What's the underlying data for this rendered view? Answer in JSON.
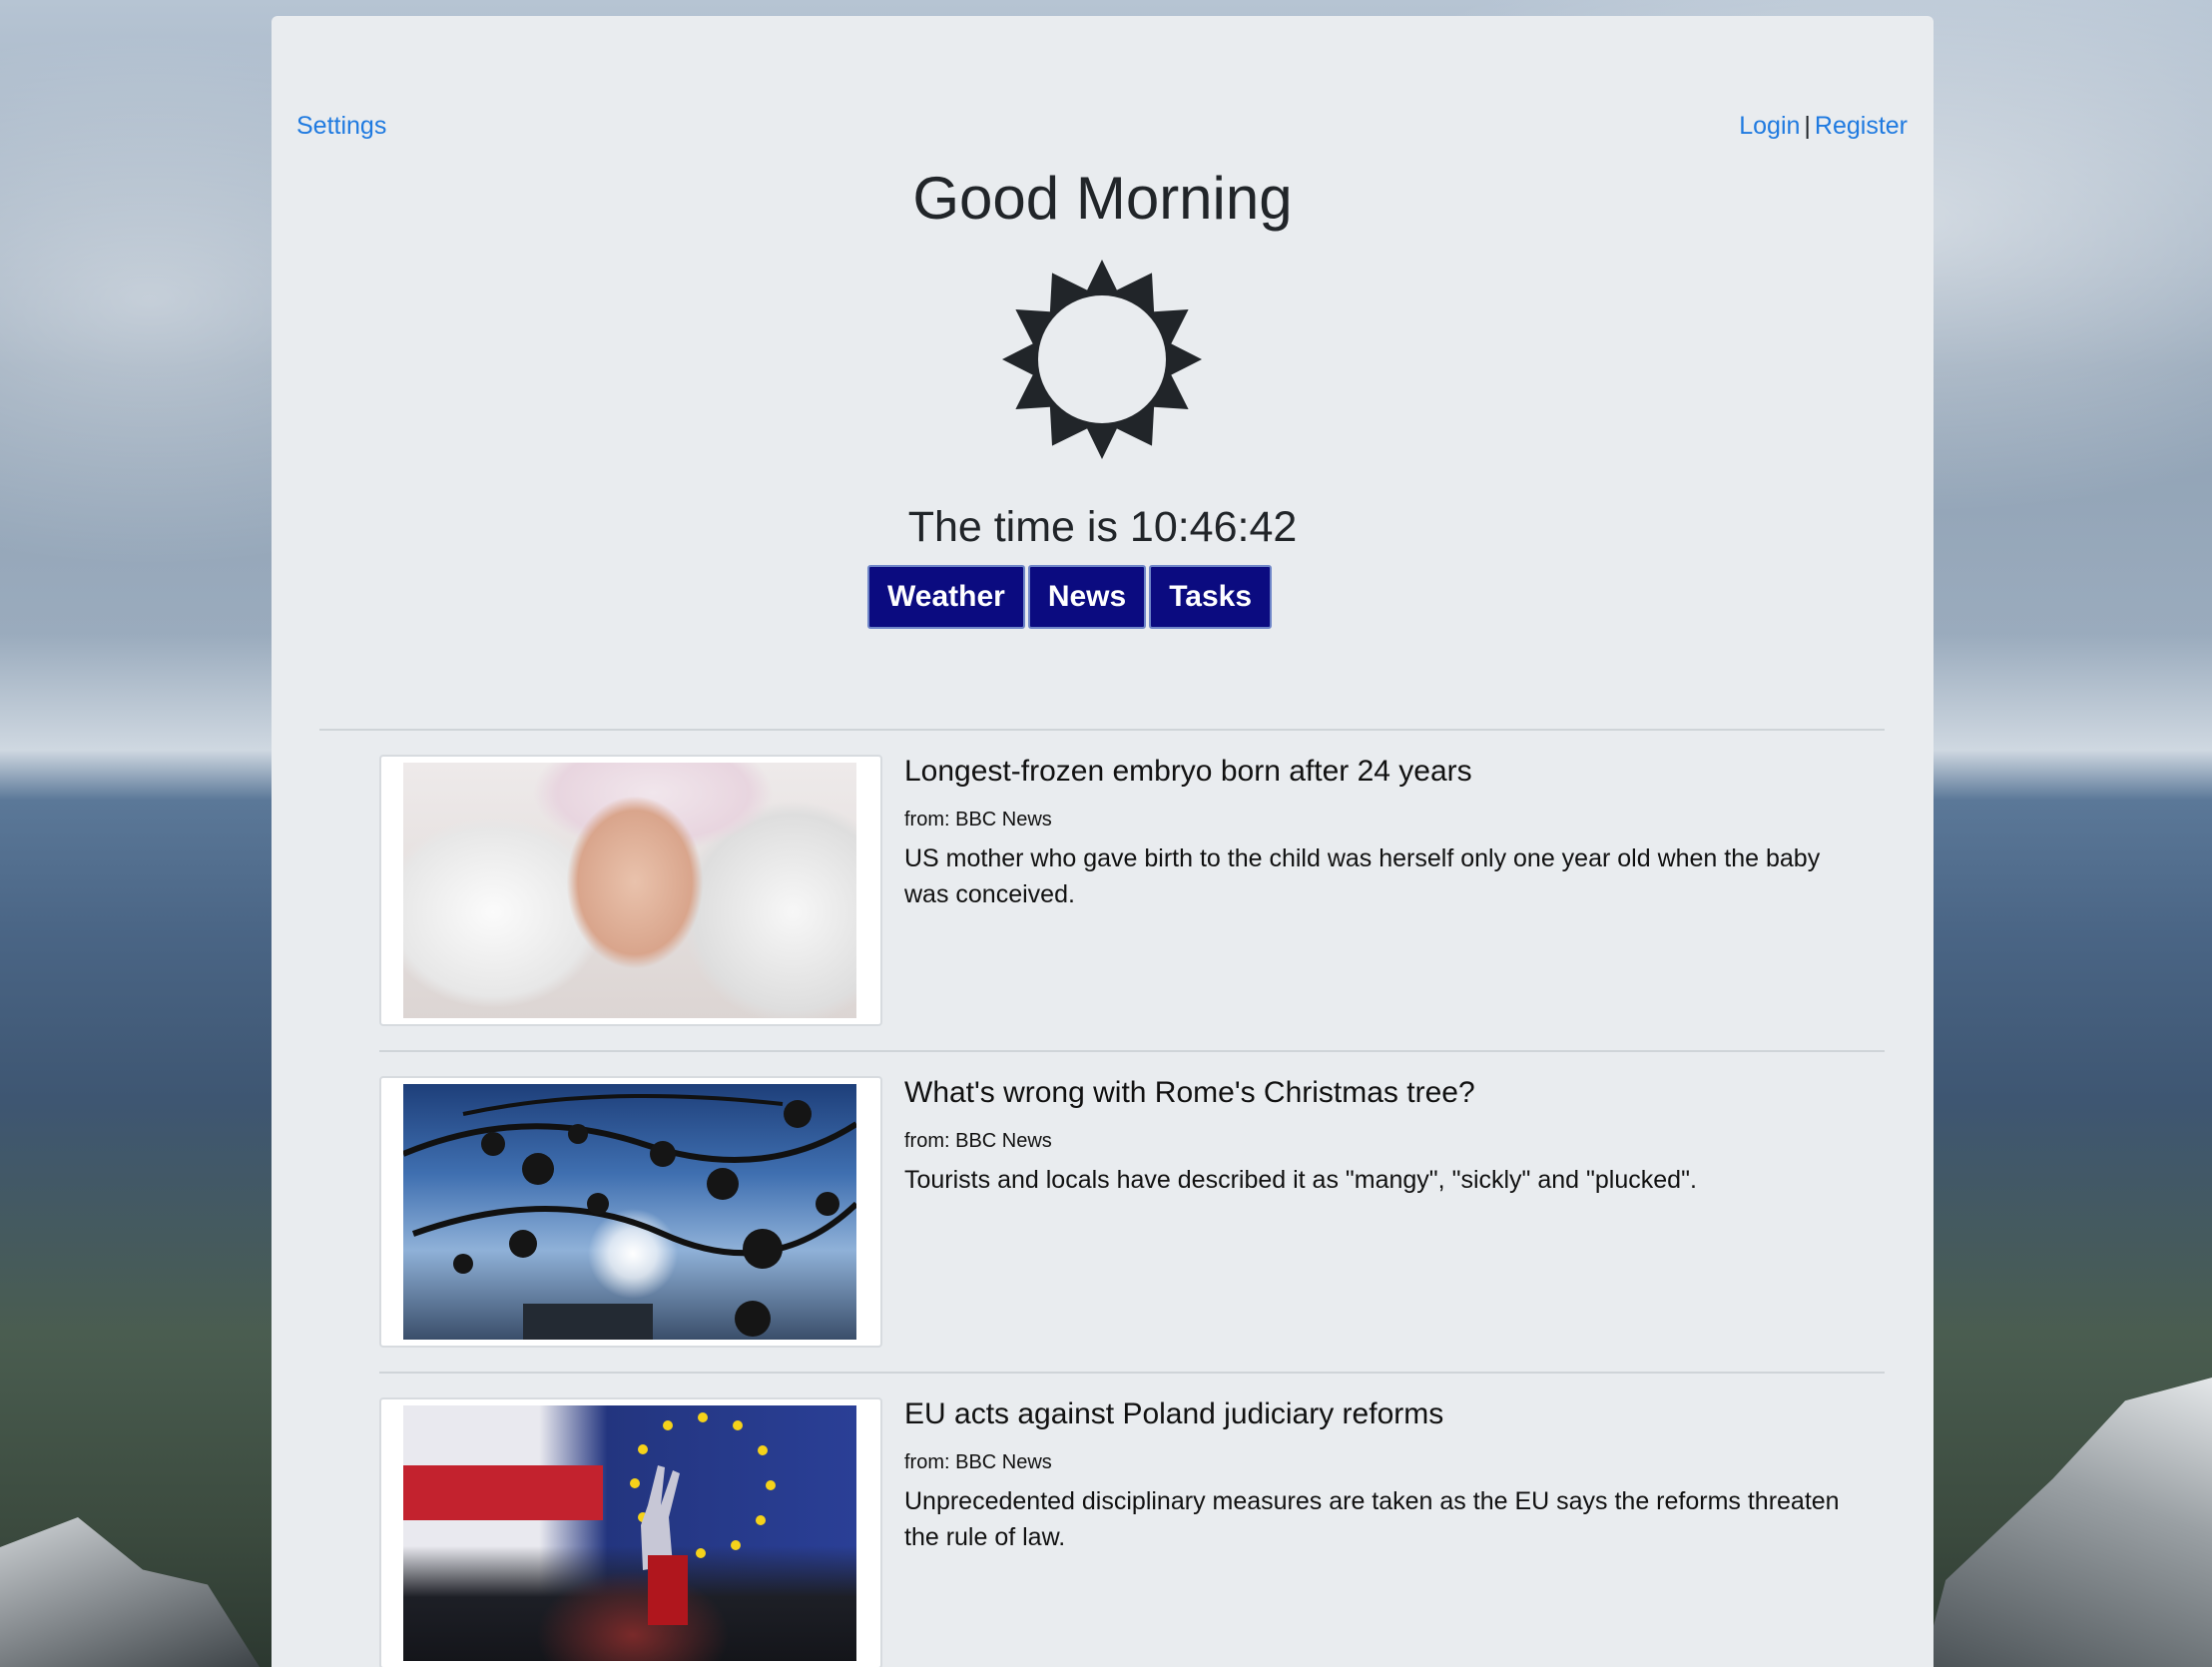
{
  "header": {
    "settings_label": "Settings",
    "login_label": "Login",
    "separator": "|",
    "register_label": "Register"
  },
  "greeting": "Good Morning",
  "weather_icon": "sun-icon",
  "time_text": "The time is 10:46:42",
  "tabs": [
    {
      "label": "Weather"
    },
    {
      "label": "News"
    },
    {
      "label": "Tasks"
    }
  ],
  "colors": {
    "tab_background": "#0b0b80",
    "link": "#1f7ae0",
    "panel": "#e9ecef"
  },
  "news": [
    {
      "title": "Longest-frozen embryo born after 24 years",
      "source": "from: BBC News",
      "description": "US mother who gave birth to the child was herself only one year old when the baby was conceived.",
      "image": "newborn-baby-photo"
    },
    {
      "title": "What's wrong with Rome's Christmas tree?",
      "source": "from: BBC News",
      "description": "Tourists and locals have described it as \"mangy\", \"sickly\" and \"plucked\".",
      "image": "christmas-tree-photo"
    },
    {
      "title": "EU acts against Poland judiciary reforms",
      "source": "from: BBC News",
      "description": "Unprecedented disciplinary measures are taken as the EU says the reforms threaten the rule of law.",
      "image": "eu-poland-protest-photo"
    }
  ]
}
